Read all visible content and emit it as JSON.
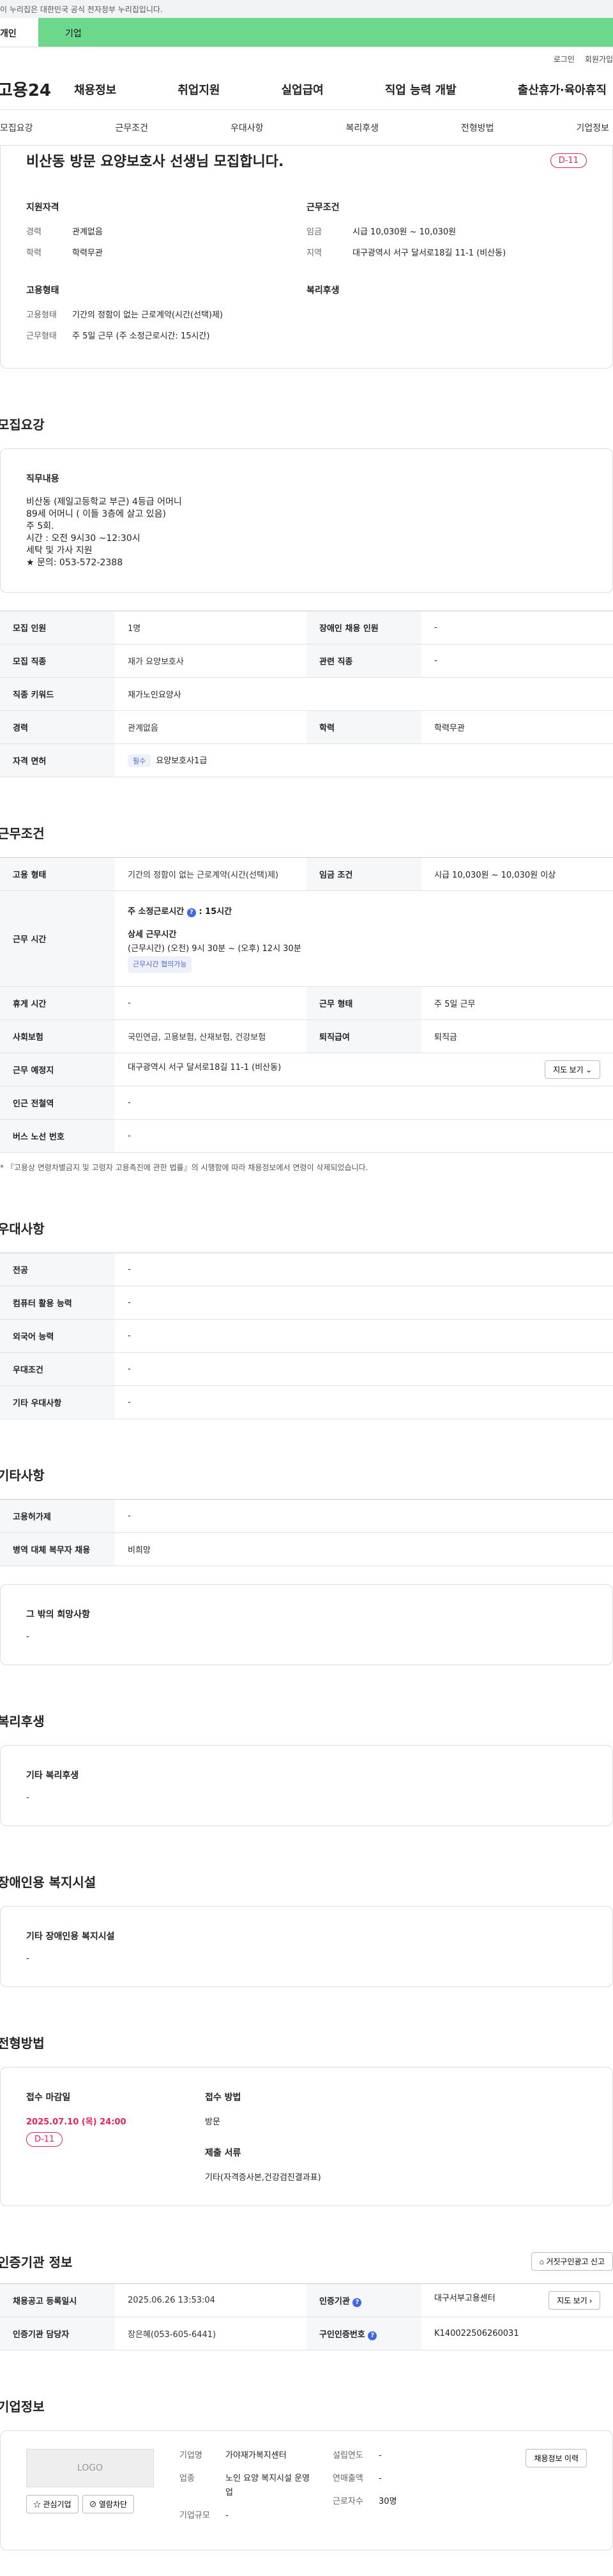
{
  "gov_banner": "이 누리집은 대한민국 공식 전자정부 누리집입니다.",
  "top_tabs": [
    "개인",
    "기업"
  ],
  "util": [
    "로그인",
    "회원가입"
  ],
  "logo": "고용24",
  "gnb": [
    "채용정보",
    "취업지원",
    "실업급여",
    "직업 능력 개발",
    "출산휴가·육아휴직"
  ],
  "anchors": [
    "모집요강",
    "근무조건",
    "우대사항",
    "복리후생",
    "전형방법",
    "기업정보"
  ],
  "summary": {
    "title": "비산동 방문 요양보호사 선생님 모집합니다.",
    "dday": "D-11",
    "left_title": "지원자격",
    "left": [
      {
        "k": "경력",
        "v": "관계없음"
      },
      {
        "k": "학력",
        "v": "학력무관"
      }
    ],
    "right_title": "근무조건",
    "right": [
      {
        "k": "임금",
        "v": "시급 10,030원 ~ 10,030원"
      },
      {
        "k": "지역",
        "v": "대구광역시 서구 달서로18길 11-1 (비산동)"
      }
    ],
    "left2_title": "고용형태",
    "left2": [
      {
        "k": "고용형태",
        "v": "기간의 정함이 없는 근로계약(시간(선택)제)"
      },
      {
        "k": "근무형태",
        "v": "주 5일 근무 (주 소정근로시간: 15시간)"
      }
    ],
    "right2_title": "복리후생"
  },
  "recruit": {
    "title": "모집요강",
    "duty_title": "직무내용",
    "duty": "비산동 (제일고등학교 부근) 4등급 어머니\n89세 어머니 ( 이들 3층에 살고 있음)\n 주 5회.\n시간 : 오전 9시30 ~12:30시\n세탁 및 가사 지원\n★ 문의: 053-572-2388",
    "rows": [
      [
        "모집 인원",
        "1명",
        "장애인 채용 인원",
        "-"
      ],
      [
        "모집 직종",
        "재가 요양보호사",
        "관련 직종",
        "-"
      ],
      [
        "직종 키워드",
        "재가노인요양사",
        "",
        ""
      ],
      [
        "경력",
        "관계없음",
        "학력",
        "학력무관"
      ]
    ],
    "license_label": "자격 면허",
    "license_chip": "필수",
    "license": "요양보호사1급"
  },
  "work": {
    "title": "근무조건",
    "type_label": "고용 형태",
    "type": "기간의 정함이 없는 근로계약(시간(선택)제)",
    "pay_label": "임금 조건",
    "pay": "시급 10,030원 ~ 10,030원 이상",
    "time_label": "근무 시간",
    "time_main": "주 소정근로시간",
    "time_hours": ": 15시간",
    "time_detail_title": "상세 근무시간",
    "time_detail": "(근무시간) (오전) 9시 30분 ~ (오후) 12시 30분",
    "time_chip": "근무시간 협의가능",
    "rows": [
      [
        "휴게 시간",
        "-",
        "근무 형태",
        "주 5일 근무"
      ],
      [
        "사회보험",
        "국민연금, 고용보험, 산재보험, 건강보험",
        "퇴직급여",
        "퇴직금"
      ]
    ],
    "place_label": "근무 예정지",
    "place": "대구광역시 서구 달서로18길 11-1 (비산동)",
    "map_btn": "지도 보기",
    "station_label": "인근 전철역",
    "station": "-",
    "bus_label": "버스 노선 번호",
    "bus": "-",
    "note": "* 『고용상 연령차별금지 및 고령자 고용촉진에 관한 법률』의 시행함에 따라 채용정보에서 연령이 삭제되었습니다."
  },
  "pref": {
    "title": "우대사항",
    "rows": [
      [
        "전공",
        "-"
      ],
      [
        "컴퓨터 활용 능력",
        "-"
      ],
      [
        "외국어 능력",
        "-"
      ],
      [
        "우대조건",
        "-"
      ],
      [
        "기타 우대사항",
        "-"
      ]
    ]
  },
  "etc": {
    "title": "기타사항",
    "rows": [
      [
        "고용허가제",
        "-"
      ],
      [
        "병역 대체 복무자 채용",
        "비희망"
      ]
    ],
    "other_title": "그 밖의 희망사항",
    "other": "-"
  },
  "welfare": {
    "title": "복리후생",
    "box_title": "기타 복리후생",
    "box": "-"
  },
  "disabled": {
    "title": "장애인용 복지시설",
    "box_title": "기타 장애인용 복지시설",
    "box": "-"
  },
  "screen": {
    "title": "전형방법",
    "deadline_title": "접수 마감일",
    "deadline": "2025.07.10 (목) 24:00",
    "dday": "D-11",
    "method_title": "접수 방법",
    "method": "방문",
    "docs_title": "제출 서류",
    "docs": "기타(자격증사본,건강검진결과표)"
  },
  "cert": {
    "title": "인증기관 정보",
    "report_btn": "거짓구인광고 신고",
    "r1": [
      "채용공고 등록일시",
      "2025.06.26 13:53:04",
      "인증기관",
      "대구서부고용센터"
    ],
    "map_btn": "지도 보기",
    "r2": [
      "인증기관 담당자",
      "장은혜(053-605-6441)",
      "구인인증번호",
      "K140022506260031"
    ]
  },
  "company": {
    "title": "기업정보",
    "logo": "LOGO",
    "fav_btn": "관심기업",
    "block_btn": "열람차단",
    "name_k": "기업명",
    "name": "가야재가복지센터",
    "biz_k": "업종",
    "biz": "노인 요양 복지시설 운영업",
    "scale_k": "기업규모",
    "scale": "-",
    "year_k": "설립연도",
    "year": "-",
    "sales_k": "연매출액",
    "sales": "-",
    "emp_k": "근로자수",
    "emp": "30명",
    "history_btn": "채용정보 이력"
  }
}
